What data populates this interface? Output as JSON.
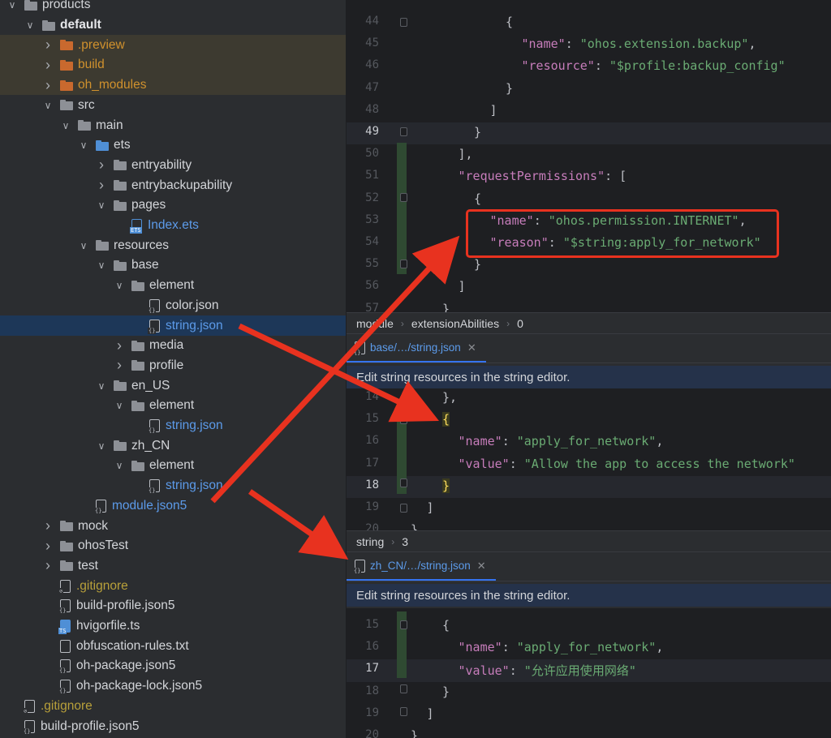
{
  "tree": {
    "rows": [
      {
        "label": "products",
        "chev": "down",
        "icon": "folder",
        "color": "plain"
      },
      {
        "label": "default",
        "chev": "down",
        "icon": "folder-module",
        "color": "bold"
      },
      {
        "label": ".preview",
        "chev": "right",
        "icon": "folder-orange",
        "color": "orange",
        "shaded": true
      },
      {
        "label": "build",
        "chev": "right",
        "icon": "folder-orange",
        "color": "orange",
        "shaded": true
      },
      {
        "label": "oh_modules",
        "chev": "right",
        "icon": "folder-orange",
        "color": "orange",
        "shaded": true
      },
      {
        "label": "src",
        "chev": "down",
        "icon": "folder",
        "color": "plain"
      },
      {
        "label": "main",
        "chev": "down",
        "icon": "folder",
        "color": "plain"
      },
      {
        "label": "ets",
        "chev": "down",
        "icon": "folder-blue",
        "color": "plain"
      },
      {
        "label": "entryability",
        "chev": "right",
        "icon": "folder",
        "color": "plain"
      },
      {
        "label": "entrybackupability",
        "chev": "right",
        "icon": "folder",
        "color": "plain"
      },
      {
        "label": "pages",
        "chev": "down",
        "icon": "folder",
        "color": "plain"
      },
      {
        "label": "Index.ets",
        "chev": "none",
        "icon": "file-ets",
        "color": "blue"
      },
      {
        "label": "resources",
        "chev": "down",
        "icon": "folder",
        "color": "plain"
      },
      {
        "label": "base",
        "chev": "down",
        "icon": "folder",
        "color": "plain"
      },
      {
        "label": "element",
        "chev": "down",
        "icon": "folder",
        "color": "plain"
      },
      {
        "label": "color.json",
        "chev": "none",
        "icon": "file-json",
        "color": "plain"
      },
      {
        "label": "string.json",
        "chev": "none",
        "icon": "file-json",
        "color": "blue",
        "selected": true
      },
      {
        "label": "media",
        "chev": "right",
        "icon": "folder",
        "color": "plain"
      },
      {
        "label": "profile",
        "chev": "right",
        "icon": "folder",
        "color": "plain"
      },
      {
        "label": "en_US",
        "chev": "down",
        "icon": "folder",
        "color": "plain"
      },
      {
        "label": "element",
        "chev": "down",
        "icon": "folder",
        "color": "plain"
      },
      {
        "label": "string.json",
        "chev": "none",
        "icon": "file-json",
        "color": "blue"
      },
      {
        "label": "zh_CN",
        "chev": "down",
        "icon": "folder",
        "color": "plain"
      },
      {
        "label": "element",
        "chev": "down",
        "icon": "folder",
        "color": "plain"
      },
      {
        "label": "string.json",
        "chev": "none",
        "icon": "file-json",
        "color": "blue"
      },
      {
        "label": "module.json5",
        "chev": "none",
        "icon": "file-json",
        "color": "blue"
      },
      {
        "label": "mock",
        "chev": "right",
        "icon": "folder",
        "color": "plain"
      },
      {
        "label": "ohosTest",
        "chev": "right",
        "icon": "folder",
        "color": "plain"
      },
      {
        "label": "test",
        "chev": "right",
        "icon": "folder",
        "color": "plain"
      },
      {
        "label": ".gitignore",
        "chev": "none",
        "icon": "file-ignore",
        "color": "olive"
      },
      {
        "label": "build-profile.json5",
        "chev": "none",
        "icon": "file-json",
        "color": "plain"
      },
      {
        "label": "hvigorfile.ts",
        "chev": "none",
        "icon": "file-ts",
        "color": "plain"
      },
      {
        "label": "obfuscation-rules.txt",
        "chev": "none",
        "icon": "file-txt",
        "color": "plain"
      },
      {
        "label": "oh-package.json5",
        "chev": "none",
        "icon": "file-json",
        "color": "plain"
      },
      {
        "label": "oh-package-lock.json5",
        "chev": "none",
        "icon": "file-json",
        "color": "plain"
      },
      {
        "label": ".gitignore",
        "chev": "none",
        "icon": "file-ignore",
        "color": "olive"
      },
      {
        "label": "build-profile.json5",
        "chev": "none",
        "icon": "file-json",
        "color": "plain"
      }
    ]
  },
  "editor1": {
    "breadcrumb": [
      "module",
      "extensionAbilities",
      "0"
    ],
    "lines": [
      {
        "n": "44",
        "code": [
          [
            "p",
            "{"
          ]
        ]
      },
      {
        "n": "45",
        "code": [
          [
            "k",
            "\"name\""
          ],
          [
            "p",
            ": "
          ],
          [
            "s",
            "\"ohos.extension.backup\""
          ],
          [
            "p",
            ","
          ]
        ]
      },
      {
        "n": "46",
        "code": [
          [
            "k",
            "\"resource\""
          ],
          [
            "p",
            ": "
          ],
          [
            "s",
            "\"$profile:backup_config\""
          ]
        ]
      },
      {
        "n": "47",
        "code": [
          [
            "p",
            "}"
          ]
        ]
      },
      {
        "n": "48",
        "code": [
          [
            "p",
            "]"
          ]
        ]
      },
      {
        "n": "49",
        "code": [
          [
            "p",
            "}"
          ]
        ]
      },
      {
        "n": "50",
        "code": [
          [
            "p",
            "],"
          ]
        ]
      },
      {
        "n": "51",
        "code": [
          [
            "k",
            "\"requestPermissions\""
          ],
          [
            "p",
            ": ["
          ]
        ]
      },
      {
        "n": "52",
        "code": [
          [
            "p",
            "{"
          ]
        ]
      },
      {
        "n": "53",
        "code": [
          [
            "k",
            "\"name\""
          ],
          [
            "p",
            ": "
          ],
          [
            "s",
            "\"ohos.permission.INTERNET\""
          ],
          [
            "p",
            ","
          ]
        ]
      },
      {
        "n": "54",
        "code": [
          [
            "k",
            "\"reason\""
          ],
          [
            "p",
            ": "
          ],
          [
            "s",
            "\"$string:apply_for_network\""
          ]
        ]
      },
      {
        "n": "55",
        "code": [
          [
            "p",
            "}"
          ]
        ]
      },
      {
        "n": "56",
        "code": [
          [
            "p",
            "]"
          ]
        ]
      },
      {
        "n": "57",
        "code": [
          [
            "p",
            "}"
          ]
        ]
      }
    ]
  },
  "editor2": {
    "tab_label": "base/…/string.json",
    "banner": "Edit string resources in the string editor.",
    "breadcrumb": [
      "string",
      "3"
    ],
    "lines": [
      {
        "n": "14",
        "code": [
          [
            "p",
            "},"
          ]
        ]
      },
      {
        "n": "15",
        "code": [
          [
            "hl",
            "{"
          ]
        ]
      },
      {
        "n": "16",
        "code": [
          [
            "k",
            "\"name\""
          ],
          [
            "p",
            ": "
          ],
          [
            "s",
            "\"apply_for_network\""
          ],
          [
            "p",
            ","
          ]
        ]
      },
      {
        "n": "17",
        "code": [
          [
            "k",
            "\"value\""
          ],
          [
            "p",
            ": "
          ],
          [
            "s",
            "\"Allow the app to access the network\""
          ]
        ]
      },
      {
        "n": "18",
        "code": [
          [
            "hl",
            "}"
          ]
        ]
      },
      {
        "n": "19",
        "code": [
          [
            "p",
            "]"
          ]
        ]
      },
      {
        "n": "20",
        "code": [
          [
            "p",
            "}"
          ]
        ]
      }
    ]
  },
  "editor3": {
    "tab_label": "zh_CN/…/string.json",
    "banner": "Edit string resources in the string editor.",
    "lines": [
      {
        "n": "15",
        "code": [
          [
            "p",
            "{"
          ]
        ]
      },
      {
        "n": "16",
        "code": [
          [
            "k",
            "\"name\""
          ],
          [
            "p",
            ": "
          ],
          [
            "s",
            "\"apply_for_network\""
          ],
          [
            "p",
            ","
          ]
        ]
      },
      {
        "n": "17",
        "code": [
          [
            "k",
            "\"value\""
          ],
          [
            "p",
            ": "
          ],
          [
            "s",
            "\"允许应用使用网络\""
          ]
        ]
      },
      {
        "n": "18",
        "code": [
          [
            "p",
            "}"
          ]
        ]
      },
      {
        "n": "19",
        "code": [
          [
            "p",
            "]"
          ]
        ]
      },
      {
        "n": "20",
        "code": [
          [
            "p",
            "}"
          ]
        ]
      }
    ]
  },
  "colors": {
    "annotation_red": "#e8321f",
    "accent_blue": "#3574f0",
    "folder_grey": "#8d9096",
    "folder_orange": "#c9692e",
    "folder_blue": "#4f8fd6"
  }
}
